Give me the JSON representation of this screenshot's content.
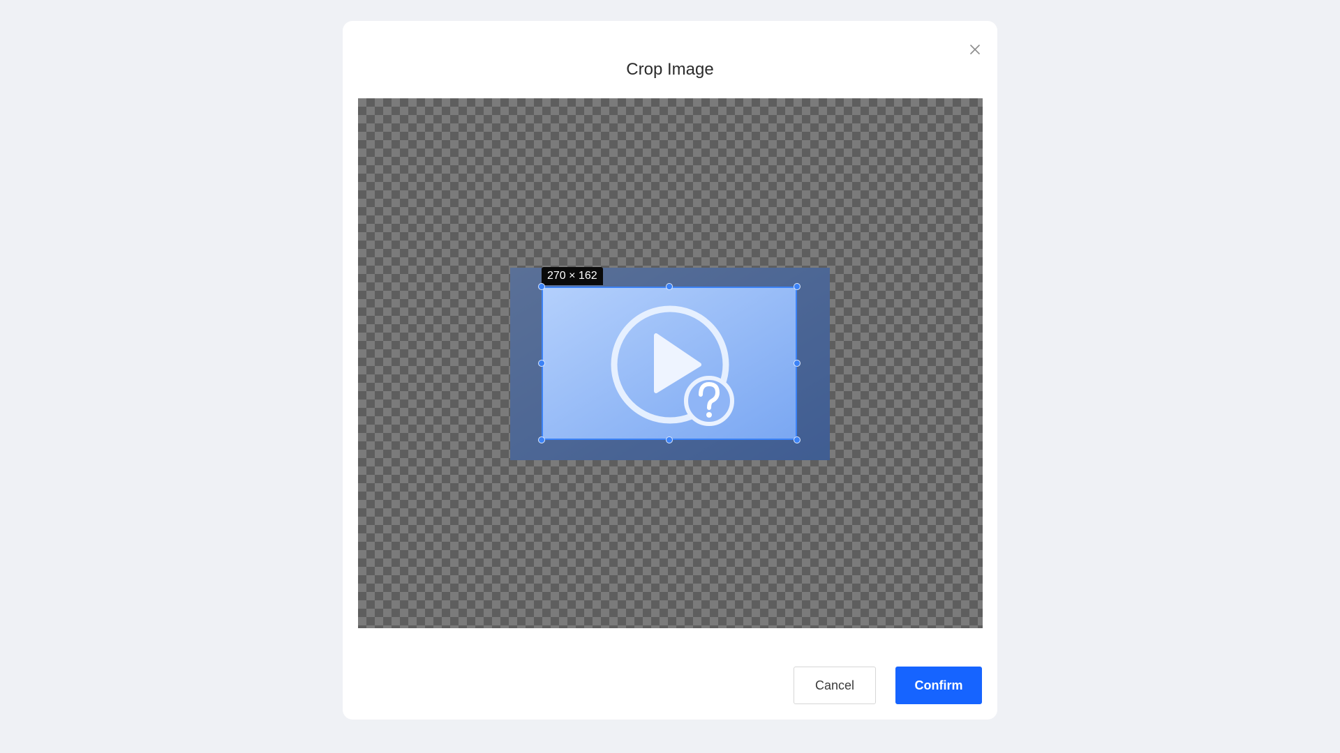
{
  "dialog": {
    "title": "Crop Image",
    "close_icon": "close-icon"
  },
  "cropper": {
    "size_label": "270 × 162",
    "image_icon": "play-question-icon",
    "accent_color": "#3b82f6"
  },
  "footer": {
    "cancel_label": "Cancel",
    "confirm_label": "Confirm",
    "confirm_color": "#1664ff"
  }
}
